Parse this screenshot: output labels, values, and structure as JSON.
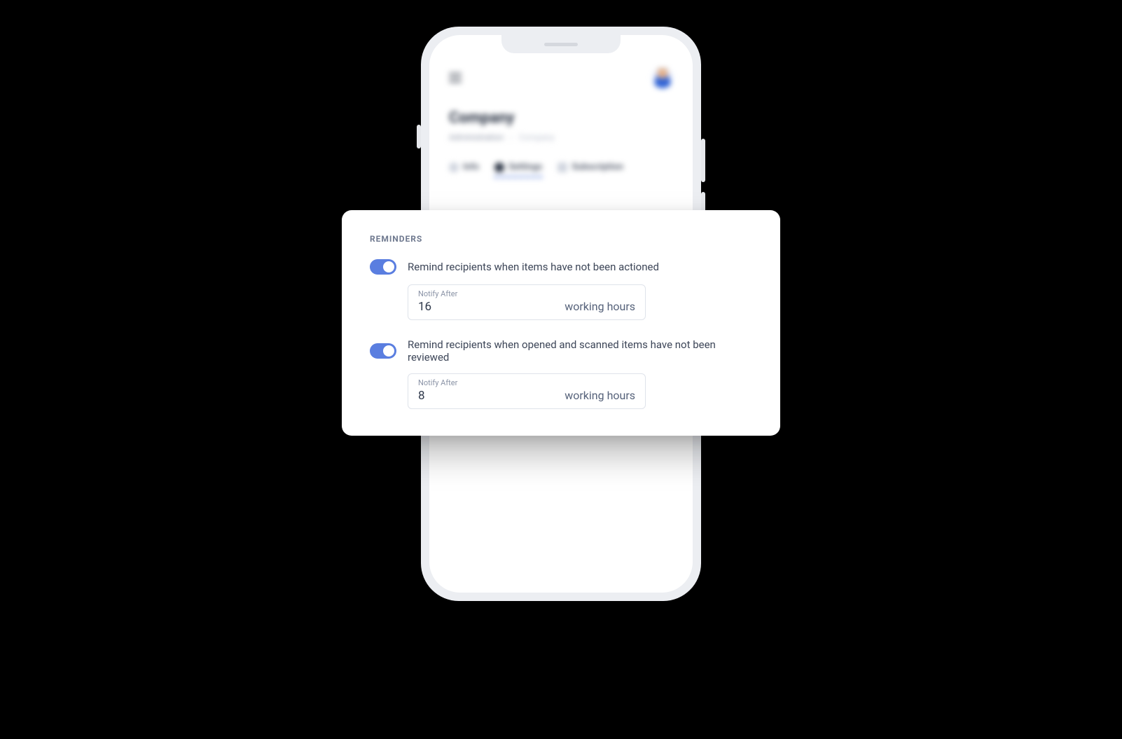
{
  "app": {
    "page_title": "Company",
    "breadcrumb": {
      "root": "Administration",
      "current": "Company"
    },
    "tabs": {
      "info": "Info",
      "settings": "Settings",
      "subscription": "Subscription"
    }
  },
  "card": {
    "title": "REMINDERS",
    "reminder1": {
      "enabled": true,
      "label": "Remind recipients when items have not been actioned",
      "field_label": "Notify After",
      "value": "16",
      "unit": "working hours"
    },
    "reminder2": {
      "enabled": true,
      "label": "Remind recipients when opened and scanned items have not been reviewed",
      "field_label": "Notify After",
      "value": "8",
      "unit": "working hours"
    }
  }
}
